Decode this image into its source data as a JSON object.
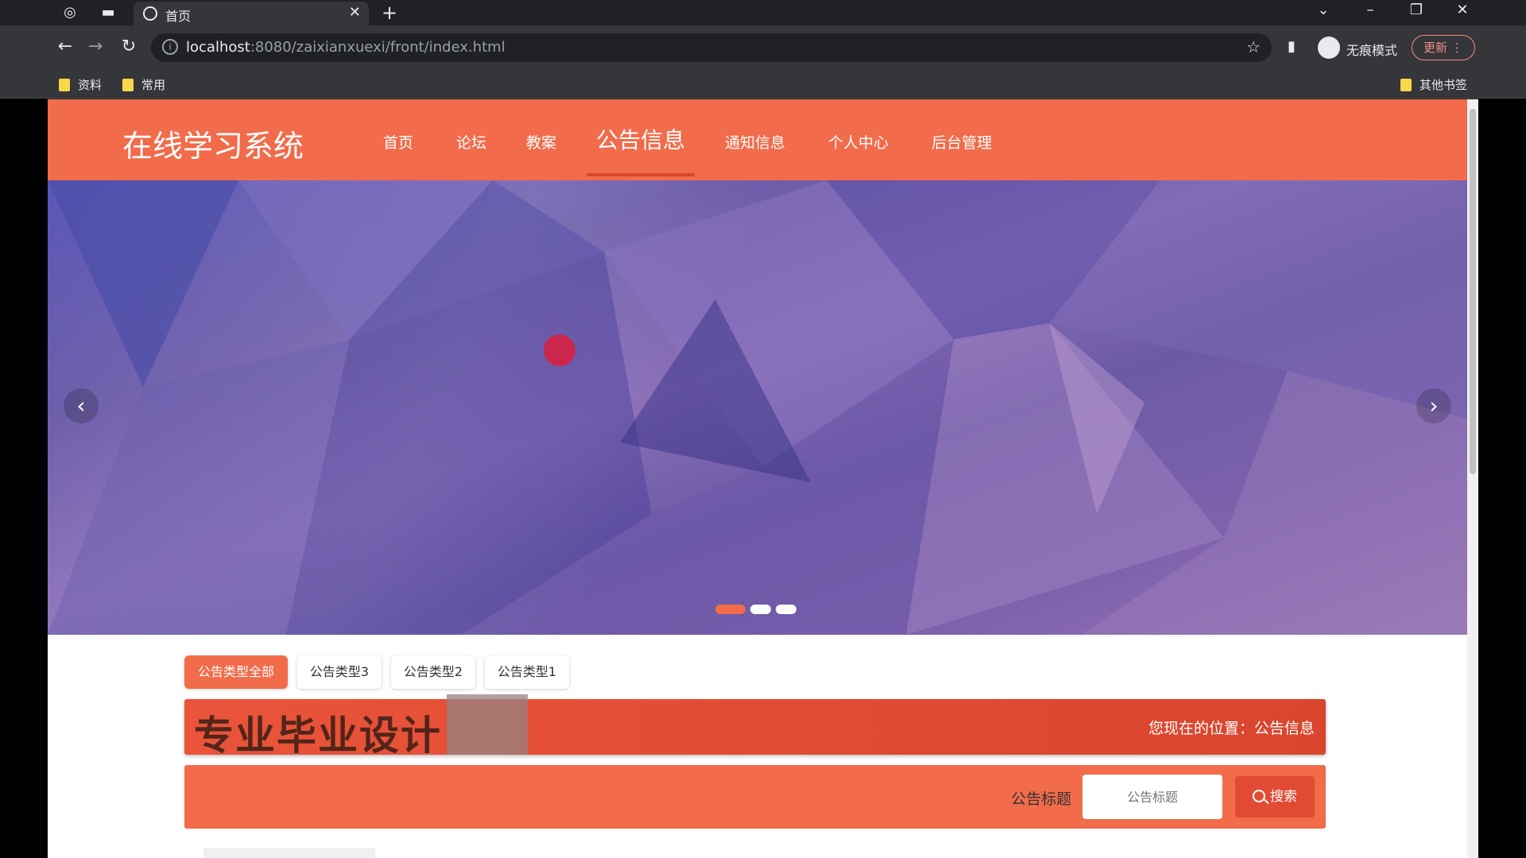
{
  "browser": {
    "tab_title": "首页",
    "url_host": "localhost",
    "url_path": ":8080/zaixianxuexi/front/index.html",
    "incognito_label": "无痕模式",
    "update_label": "更新",
    "bookmarks": [
      "资料",
      "常用"
    ],
    "other_bookmarks": "其他书签"
  },
  "site": {
    "logo": "在线学习系统",
    "nav": [
      {
        "label": "首页",
        "active": false
      },
      {
        "label": "论坛",
        "active": false
      },
      {
        "label": "教案",
        "active": false
      },
      {
        "label": "公告信息",
        "active": true
      },
      {
        "label": "通知信息",
        "active": false
      },
      {
        "label": "个人中心",
        "active": false
      },
      {
        "label": "后台管理",
        "active": false
      }
    ],
    "accent_color": "#f26b4a"
  },
  "carousel": {
    "slide_count": 3,
    "active_index": 0,
    "prev_icon": "chevron-left-icon",
    "next_icon": "chevron-right-icon"
  },
  "filters": [
    "公告类型全部",
    "公告类型3",
    "公告类型2",
    "公告类型1"
  ],
  "banner": {
    "watermark": "专业毕业设计",
    "location": "您现在的位置：公告信息"
  },
  "search": {
    "label": "公告标题",
    "placeholder": "公告标题",
    "button_label": "搜索"
  }
}
